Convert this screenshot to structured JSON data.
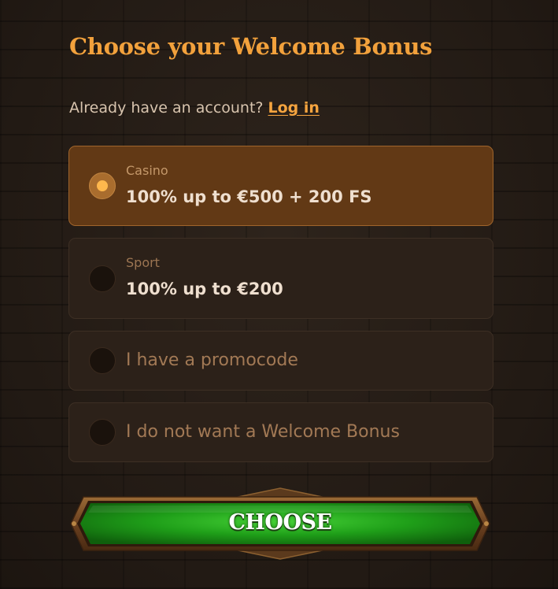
{
  "title": "Choose your Welcome Bonus",
  "account": {
    "prompt": "Already have an account?",
    "login_link": "Log in"
  },
  "options": [
    {
      "label": "Casino",
      "value": "100% up to €500 + 200 FS",
      "selected": true
    },
    {
      "label": "Sport",
      "value": "100% up to €200",
      "selected": false
    },
    {
      "text": "I have a promocode",
      "selected": false
    },
    {
      "text": "I do not want a Welcome Bonus",
      "selected": false
    }
  ],
  "choose_button": {
    "label": "CHOOSE"
  },
  "colors": {
    "accent": "#f2a13c",
    "selected_bg": "#623915",
    "option_bg": "#2c2119",
    "button_green": "#1fa11b"
  },
  "icons": {
    "radio_selected": "radio-selected-icon",
    "radio_empty": "radio-empty-icon"
  }
}
